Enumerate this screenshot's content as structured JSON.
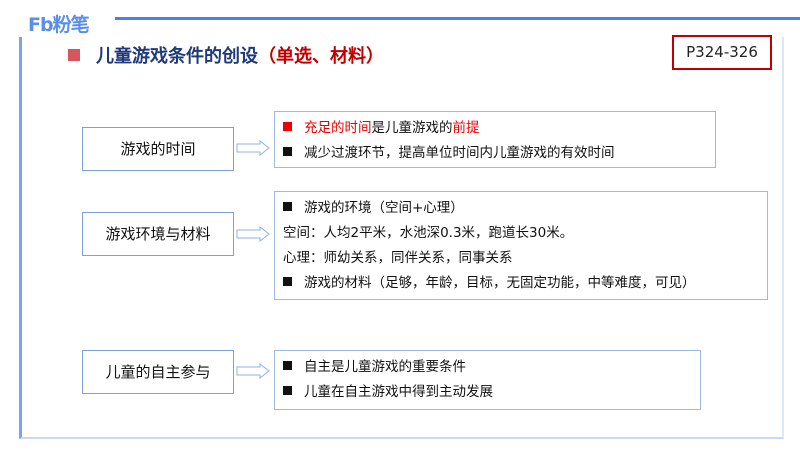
{
  "logo": "Fb粉笔",
  "title": {
    "main": "儿童游戏条件的创设",
    "note": "（单选、材料）"
  },
  "page_ref": "P324-326",
  "sections": [
    {
      "label": "游戏的时间",
      "lines": [
        {
          "bullet": "red",
          "parts": [
            {
              "t": "充足的时间",
              "red": true
            },
            {
              "t": "是儿童游戏的",
              "red": false
            },
            {
              "t": "前提",
              "red": true
            }
          ]
        },
        {
          "bullet": "black",
          "text": "减少过渡环节，提高单位时间内儿童游戏的有效时间"
        }
      ]
    },
    {
      "label": "游戏环境与材料",
      "lines": [
        {
          "bullet": "black",
          "text": "游戏的环境（空间+心理）"
        },
        {
          "text": "空间：人均2平米，水池深0.3米，跑道长30米。"
        },
        {
          "text": "心理：师幼关系，同伴关系，同事关系"
        },
        {
          "bullet": "black",
          "text": "游戏的材料（足够，年龄，目标，无固定功能，中等难度，可见）"
        }
      ]
    },
    {
      "label": "儿童的自主参与",
      "lines": [
        {
          "bullet": "black",
          "text": "自主是儿童游戏的重要条件"
        },
        {
          "bullet": "black",
          "text": "儿童在自主游戏中得到主动发展"
        }
      ]
    }
  ],
  "colors": {
    "accent": "#4f7fe0",
    "red": "#c00000"
  }
}
